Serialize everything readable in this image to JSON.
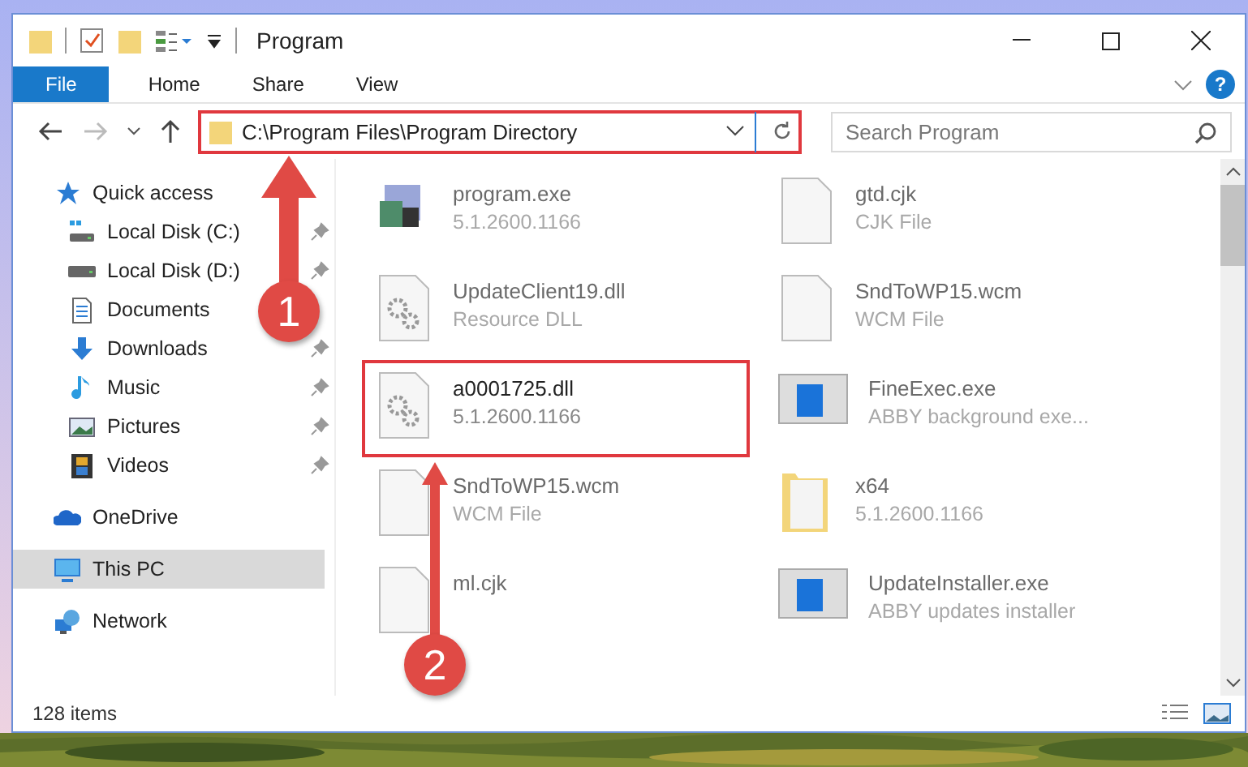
{
  "window": {
    "title": "Program"
  },
  "ribbon": {
    "tabs": [
      {
        "label": "File",
        "selected": true
      },
      {
        "label": "Home",
        "selected": false
      },
      {
        "label": "Share",
        "selected": false
      },
      {
        "label": "View",
        "selected": false
      }
    ],
    "help": "?"
  },
  "address": {
    "path": "C:\\Program Files\\Program Directory",
    "highlighted": true
  },
  "search": {
    "placeholder": "Search Program"
  },
  "nav": [
    {
      "label": "Quick access",
      "kind": "star",
      "selected": false,
      "children": [
        {
          "label": "Local Disk (C:)",
          "kind": "disk-c",
          "pinned": true,
          "selected": false
        },
        {
          "label": "Local Disk (D:)",
          "kind": "disk",
          "pinned": true,
          "selected": false
        },
        {
          "label": "Documents",
          "kind": "document",
          "pinned": false,
          "selected": false
        },
        {
          "label": "Downloads",
          "kind": "download",
          "pinned": true,
          "selected": false
        },
        {
          "label": "Music",
          "kind": "music",
          "pinned": true,
          "selected": false
        },
        {
          "label": "Pictures",
          "kind": "pictures",
          "pinned": true,
          "selected": false
        },
        {
          "label": "Videos",
          "kind": "videos",
          "pinned": true,
          "selected": false
        }
      ]
    },
    {
      "label": "OneDrive",
      "kind": "cloud",
      "selected": false
    },
    {
      "label": "This PC",
      "kind": "pc",
      "selected": true
    },
    {
      "label": "Network",
      "kind": "network",
      "selected": false
    }
  ],
  "files": [
    {
      "name": "program.exe",
      "detail": "5.1.2600.1166",
      "kind": "exe",
      "highlighted": false
    },
    {
      "name": "UpdateClient19.dll",
      "detail": "Resource DLL",
      "kind": "dll",
      "highlighted": false
    },
    {
      "name": "a0001725.dll",
      "detail": "5.1.2600.1166",
      "kind": "dll",
      "highlighted": true
    },
    {
      "name": "SndToWP15.wcm",
      "detail": "WCM File",
      "kind": "file",
      "highlighted": false
    },
    {
      "name": "ml.cjk",
      "kind": "file",
      "highlighted": false
    },
    {
      "name": "gtd.cjk",
      "detail": "CJK File",
      "kind": "file",
      "highlighted": false
    },
    {
      "name": "SndToWP15.wcm",
      "detail": "WCM File",
      "kind": "file",
      "highlighted": false
    },
    {
      "name": "FineExec.exe",
      "detail": "ABBY background exe...",
      "kind": "app",
      "highlighted": false
    },
    {
      "name": "x64",
      "detail": "5.1.2600.1166",
      "kind": "folder",
      "highlighted": false
    },
    {
      "name": "UpdateInstaller.exe",
      "detail": "ABBY updates installer",
      "kind": "app",
      "highlighted": false
    }
  ],
  "status_bar": {
    "count": "128 items"
  },
  "annotations": [
    {
      "label": "1"
    },
    {
      "label": "2"
    }
  ]
}
